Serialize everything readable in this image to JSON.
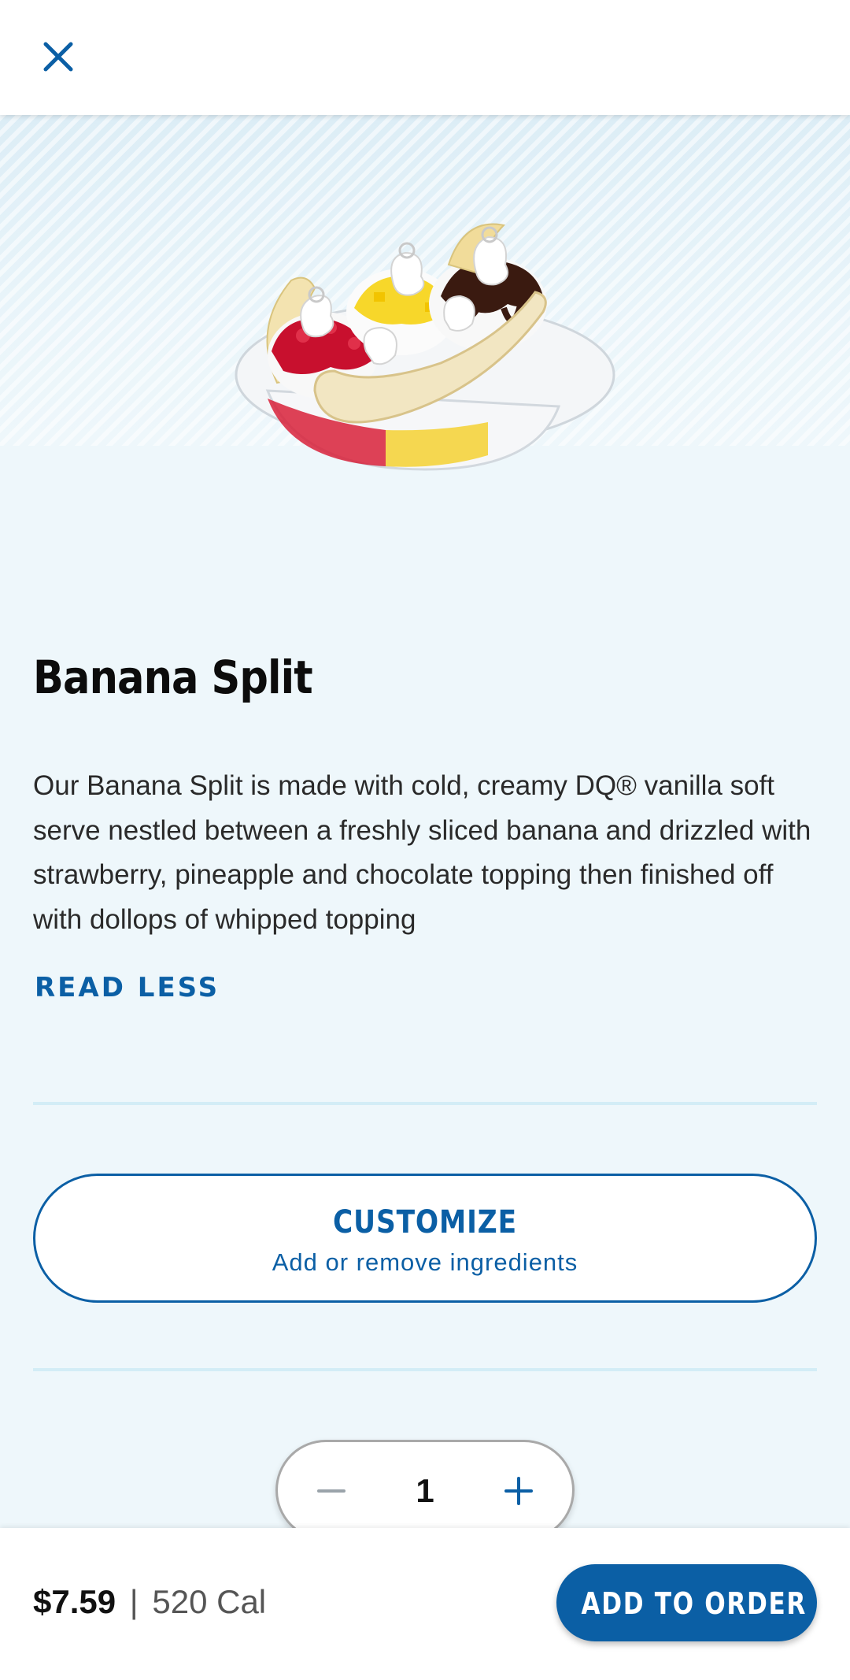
{
  "header": {
    "close_icon": "close-icon"
  },
  "product": {
    "image_icon": "banana-split-image",
    "title": "Banana Split",
    "description": "Our Banana Split is made with cold, creamy DQ® vanilla soft serve nestled between a freshly sliced banana and drizzled with strawberry, pineapple and chocolate topping then finished off with dollops of whipped topping",
    "read_less_label": "READ LESS"
  },
  "customize": {
    "title": "CUSTOMIZE",
    "subtitle": "Add or remove ingredients"
  },
  "quantity": {
    "value": "1",
    "minus_icon": "minus-icon",
    "plus_icon": "plus-icon"
  },
  "footer": {
    "price": "$7.59",
    "separator": "|",
    "calories": "520 Cal",
    "add_button_label": "ADD TO ORDER"
  },
  "colors": {
    "brand_blue": "#0b5fa5",
    "background": "#eef7fb",
    "divider": "#d3edf6"
  }
}
